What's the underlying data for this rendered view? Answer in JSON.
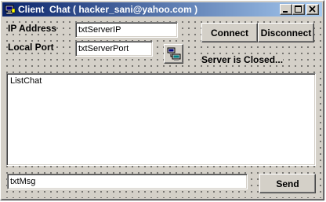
{
  "window": {
    "title": "Client  Chat ( hacker_sani@yahoo.com )",
    "app_icon": "chat-app-icon",
    "controls": {
      "minimize_icon": "minimize-icon",
      "maximize_icon": "maximize-icon",
      "close_icon": "close-icon"
    }
  },
  "connection": {
    "ip_label": "IP Address",
    "ip_value": "txtServerIP",
    "port_label": "Local Port",
    "port_value": "txtServerPort",
    "network_button_icon": "network-computers-icon",
    "connect_label": "Connect",
    "disconnect_label": "Disconnect",
    "status_text": "Server is Closed..."
  },
  "chat": {
    "list_items": [
      "ListChat"
    ]
  },
  "message": {
    "input_value": "txtMsg",
    "send_label": "Send"
  },
  "colors": {
    "title_gradient_start": "#0a246a",
    "title_gradient_end": "#a6caf0",
    "face": "#d4d0c8"
  }
}
